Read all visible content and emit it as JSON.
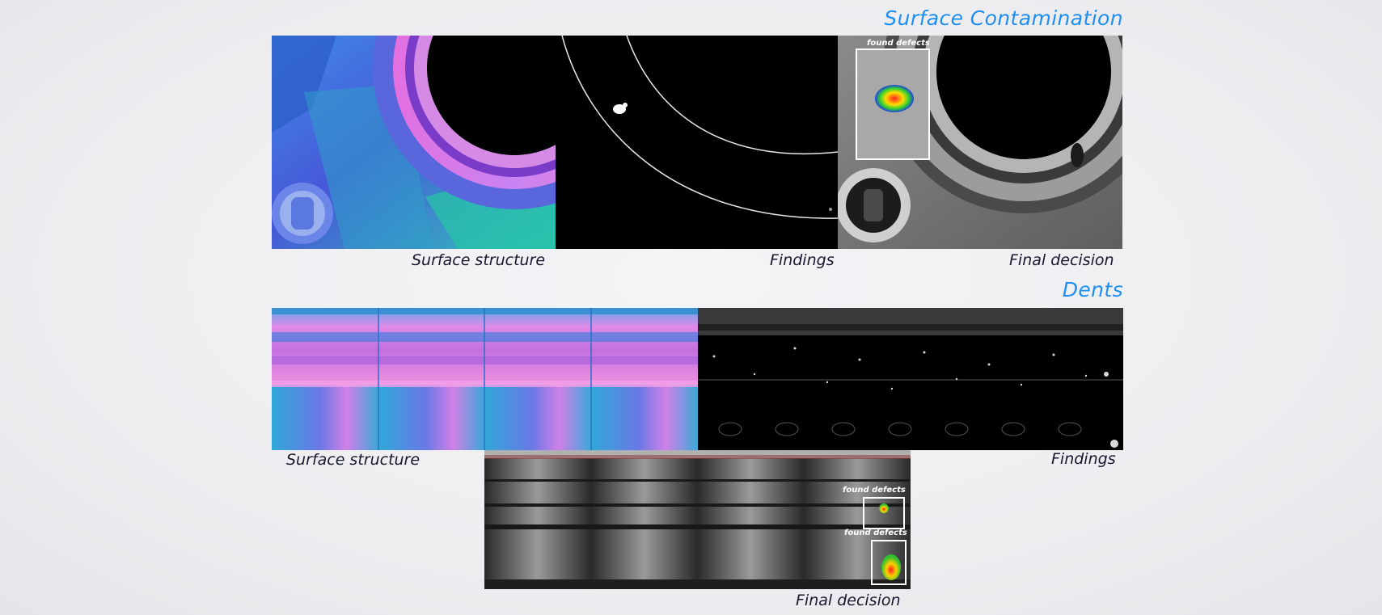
{
  "sections": {
    "contamination": {
      "title": "Surface Contamination",
      "captions": {
        "structure": "Surface structure",
        "findings": "Findings",
        "decision": "Final decision"
      },
      "defect_label": "found defects"
    },
    "dents": {
      "title": "Dents",
      "captions": {
        "structure": "Surface structure",
        "findings": "Findings",
        "decision": "Final decision"
      },
      "defect_labels": [
        "found defects",
        "found defects"
      ]
    }
  },
  "colors": {
    "title": "#1e8ff0",
    "caption": "#17172e",
    "background": "#efeff2"
  }
}
